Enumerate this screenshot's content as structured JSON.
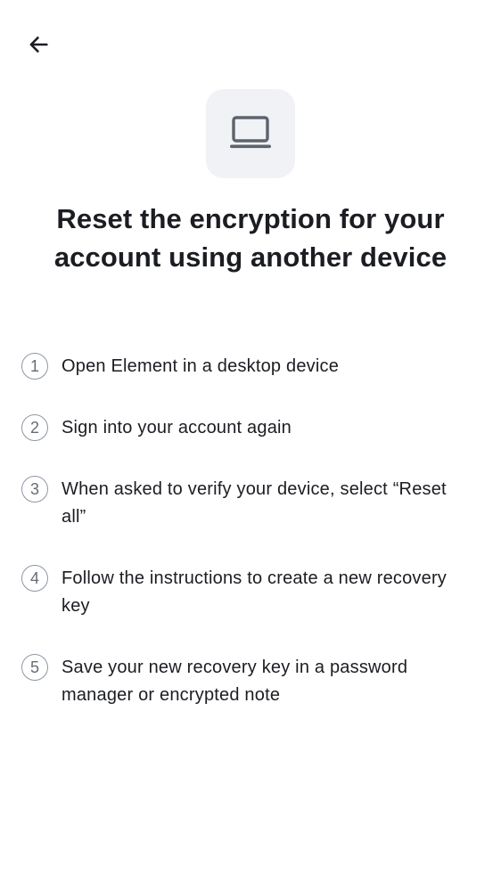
{
  "header": {
    "back_icon": "arrow-left-icon"
  },
  "hero": {
    "icon": "laptop-icon",
    "badge_color": "#f0f2f5"
  },
  "title": "Reset the encryption for your account using another device",
  "steps": [
    {
      "number": "1",
      "text": "Open Element in a desktop device"
    },
    {
      "number": "2",
      "text": "Sign into your account again"
    },
    {
      "number": "3",
      "text": "When asked to verify your device, select “Reset all”"
    },
    {
      "number": "4",
      "text": "Follow the instructions to create a new recovery key"
    },
    {
      "number": "5",
      "text": "Save your new recovery key in a password manager or encrypted note"
    }
  ],
  "colors": {
    "text_primary": "#1b1d22",
    "step_circle_border": "#8d97a5",
    "step_number": "#656d77",
    "background": "#ffffff"
  }
}
